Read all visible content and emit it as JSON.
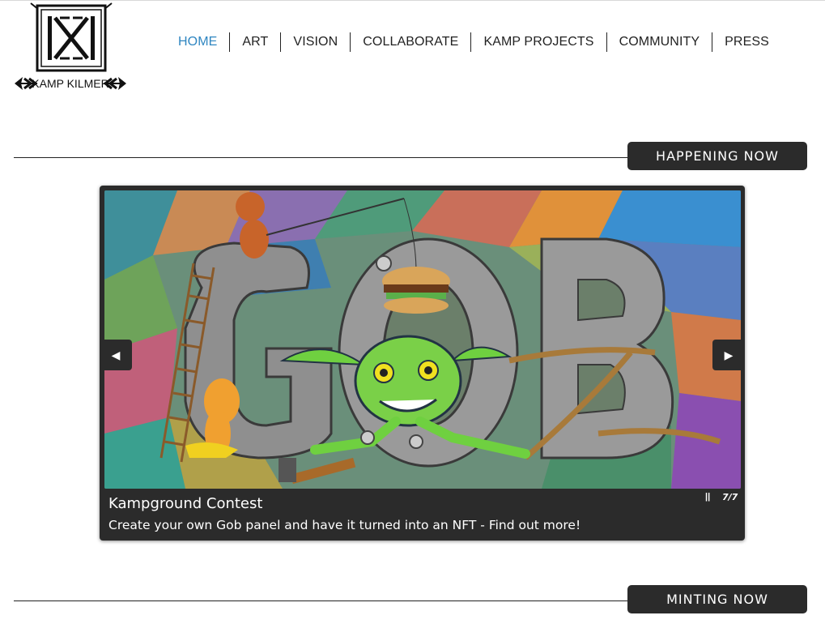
{
  "brand": {
    "name": "KAMP KILMER"
  },
  "nav": {
    "items": [
      {
        "label": "HOME",
        "active": true
      },
      {
        "label": "ART"
      },
      {
        "label": "VISION"
      },
      {
        "label": "COLLABORATE"
      },
      {
        "label": "KAMP PROJECTS"
      },
      {
        "label": "COMMUNITY"
      },
      {
        "label": "PRESS"
      }
    ],
    "active_color": "#2f86c1"
  },
  "sections": {
    "happening": {
      "label": "HAPPENING NOW"
    },
    "minting": {
      "label": "MINTING NOW"
    }
  },
  "slideshow": {
    "prev_icon": "◀",
    "next_icon": "▶",
    "pause_icon": "⏸",
    "title": "Kampground Contest",
    "description": "Create your own Gob panel and have it turned into an NFT - Find out more!",
    "counter": "7/7",
    "current": 7,
    "total": 7
  }
}
